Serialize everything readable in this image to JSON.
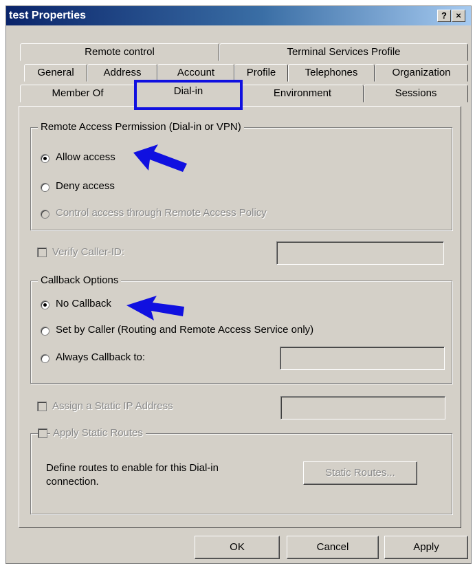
{
  "window": {
    "title": "test Properties",
    "help_glyph": "?",
    "close_glyph": "×"
  },
  "tabs": {
    "row1": [
      "Remote control",
      "Terminal Services Profile"
    ],
    "row2": [
      "General",
      "Address",
      "Account",
      "Profile",
      "Telephones",
      "Organization"
    ],
    "row3": [
      "Member Of",
      "Dial-in",
      "Environment",
      "Sessions"
    ]
  },
  "remote_access": {
    "legend": "Remote Access Permission (Dial-in or VPN)",
    "allow": "Allow access",
    "deny": "Deny access",
    "policy": "Control access through Remote Access Policy",
    "selected": "allow"
  },
  "verify_caller_id": {
    "label": "Verify Caller-ID:",
    "value": ""
  },
  "callback": {
    "legend": "Callback Options",
    "none": "No Callback",
    "caller": "Set by Caller (Routing and Remote Access Service only)",
    "always": "Always Callback to:",
    "selected": "none",
    "always_value": ""
  },
  "static_ip": {
    "label": "Assign a Static IP Address",
    "value": ""
  },
  "static_routes": {
    "label": "Apply Static Routes",
    "description": "Define routes to enable for this Dial-in connection.",
    "button": "Static Routes..."
  },
  "footer": {
    "ok": "OK",
    "cancel": "Cancel",
    "apply": "Apply"
  },
  "annotations": {
    "arrow_color": "#1010e0",
    "highlight_color": "#1010e0"
  }
}
